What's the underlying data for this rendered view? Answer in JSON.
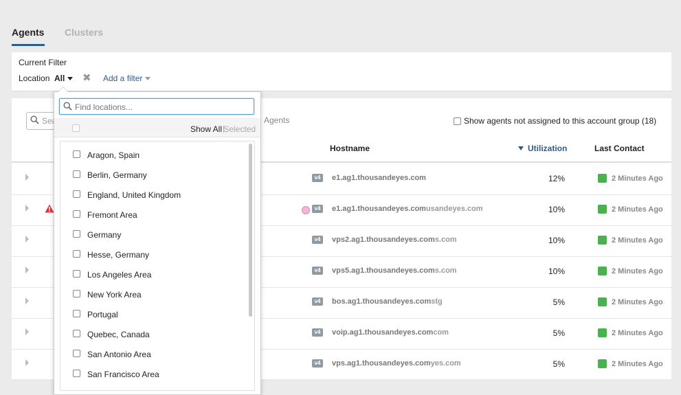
{
  "tabs": [
    {
      "label": "Agents",
      "active": true
    },
    {
      "label": "Clusters",
      "active": false
    }
  ],
  "filter": {
    "current_filter_label": "Current Filter",
    "location_label": "Location",
    "location_value": "All",
    "clear_icon": "close-icon",
    "add_filter_label": "Add a filter"
  },
  "toolbar": {
    "search_placeholder": "Search",
    "agents_label": "Agents",
    "show_unassigned_label": "Show agents not assigned to this account group (18)"
  },
  "table": {
    "columns": [
      "Hostname",
      "Utilization",
      "Last Contact"
    ],
    "sorted_column": "Utilization",
    "rows": [
      {
        "ip": "v4",
        "hostname": "e1.ag1.thousandeyes.com",
        "hostname_rest": "",
        "utilization": "12%",
        "last_contact": "2 Minutes Ago",
        "warning": false,
        "pink_dot": false
      },
      {
        "ip": "v4",
        "hostname": "e1.ag1.thousandeyes.com",
        "hostname_rest": "usandeyes.com",
        "utilization": "10%",
        "last_contact": "2 Minutes Ago",
        "warning": true,
        "pink_dot": true
      },
      {
        "ip": "v4",
        "hostname": "vps2.ag1.thousandeyes.com",
        "hostname_rest": "s.com",
        "utilization": "10%",
        "last_contact": "2 Minutes Ago",
        "warning": false,
        "pink_dot": false
      },
      {
        "ip": "v4",
        "hostname": "vps5.ag1.thousandeyes.com",
        "hostname_rest": "s.com",
        "utilization": "10%",
        "last_contact": "2 Minutes Ago",
        "warning": false,
        "pink_dot": false
      },
      {
        "ip": "v4",
        "hostname": "bos.ag1.thousandeyes.com",
        "hostname_rest": "stg",
        "utilization": "5%",
        "last_contact": "2 Minutes Ago",
        "warning": false,
        "pink_dot": false
      },
      {
        "ip": "v4",
        "hostname": "voip.ag1.thousandeyes.com",
        "hostname_rest": "com",
        "utilization": "5%",
        "last_contact": "2 Minutes Ago",
        "warning": false,
        "pink_dot": false
      },
      {
        "ip": "v4",
        "hostname": "vps.ag1.thousandeyes.com",
        "hostname_rest": "yes.com",
        "utilization": "5%",
        "last_contact": "2 Minutes Ago",
        "warning": false,
        "pink_dot": false
      }
    ],
    "status_color": "#4caf50"
  },
  "location_dropdown": {
    "search_placeholder": "Find locations...",
    "show_all_label": "Show All",
    "selected_label": "Selected",
    "locations": [
      "Aragon, Spain",
      "Berlin, Germany",
      "England, United Kingdom",
      "Fremont Area",
      "Germany",
      "Hesse, Germany",
      "Los Angeles Area",
      "New York Area",
      "Portugal",
      "Quebec, Canada",
      "San Antonio Area",
      "San Francisco Area"
    ]
  },
  "colors": {
    "accent": "#2f5d8a",
    "status_ok": "#4caf50",
    "warning": "#d9363e"
  }
}
